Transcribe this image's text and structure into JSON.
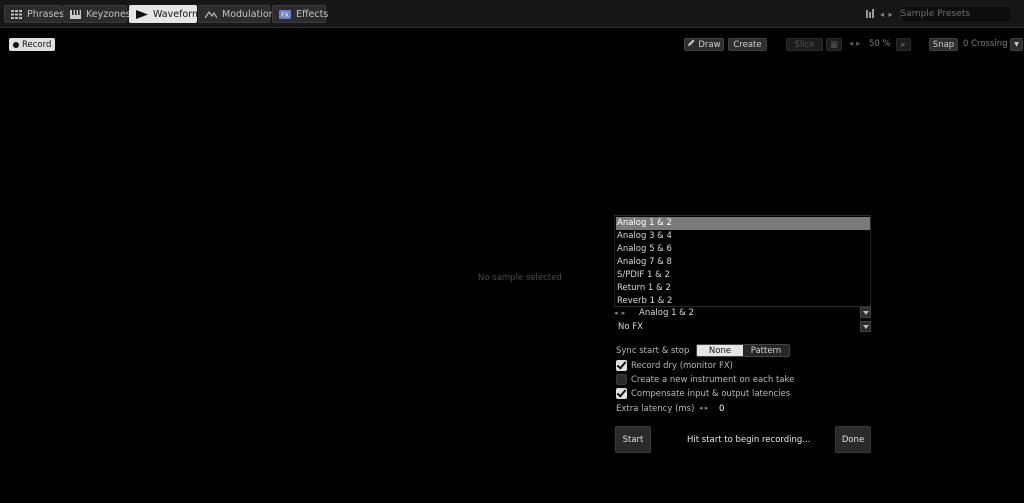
{
  "tabs": [
    {
      "label": "Phrases",
      "icon": "grid-icon"
    },
    {
      "label": "Keyzones",
      "icon": "keyboard-icon"
    },
    {
      "label": "Waveform",
      "icon": "waveform-icon",
      "active": true
    },
    {
      "label": "Modulation",
      "icon": "modulation-icon"
    },
    {
      "label": "Effects",
      "icon": "fx-icon"
    }
  ],
  "presets": {
    "label": "Sample Presets"
  },
  "toolbar": {
    "record_label": "Record",
    "draw_label": "Draw",
    "create_label": "Create",
    "slice_label": "Slice",
    "zoom_value": "50 %",
    "snap_label": "Snap",
    "crossing_label": "0 Crossing"
  },
  "waveform": {
    "empty_text": "No sample selected"
  },
  "record_panel": {
    "input_options": [
      "Analog 1 & 2",
      "Analog 3 & 4",
      "Analog 5 & 6",
      "Analog 7 & 8",
      "S/PDIF 1 & 2",
      "Return 1 & 2",
      "Reverb 1 & 2"
    ],
    "selected_input": "Analog 1 & 2",
    "fx_value": "No FX",
    "sync_label": "Sync start & stop",
    "sync_none": "None",
    "sync_pattern": "Pattern",
    "record_dry_label": "Record dry (monitor FX)",
    "record_dry_checked": true,
    "new_instrument_label": "Create a new instrument on each take",
    "new_instrument_checked": false,
    "compensate_label": "Compensate input & output latencies",
    "compensate_checked": true,
    "extra_latency_label": "Extra latency (ms)",
    "extra_latency_value": "0",
    "start_label": "Start",
    "status_text": "Hit start to begin recording...",
    "done_label": "Done"
  },
  "colors": {
    "background": "#000000",
    "tab_bg": "#2c2c2c",
    "active_tab": "#e6e6e6",
    "selected_item": "#7a7a7a"
  }
}
